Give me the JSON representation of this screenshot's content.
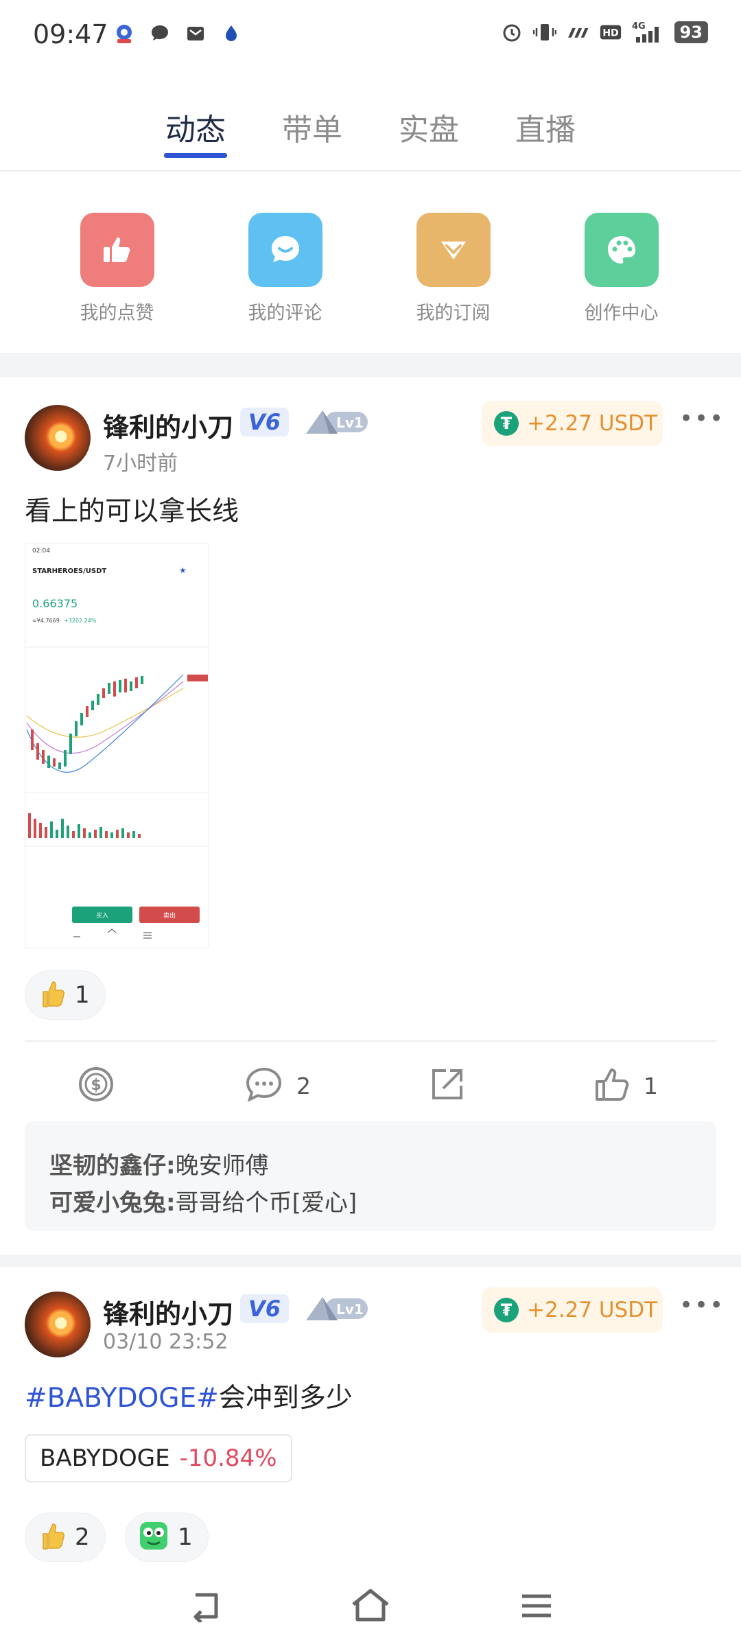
{
  "status_bar": {
    "time": "09:47",
    "battery": "93",
    "network": "4G"
  },
  "tabs": [
    {
      "label": "动态",
      "active": true
    },
    {
      "label": "带单",
      "active": false
    },
    {
      "label": "实盘",
      "active": false
    },
    {
      "label": "直播",
      "active": false
    }
  ],
  "quick_actions": [
    {
      "label": "我的点赞",
      "icon": "thumbs-up-icon",
      "color": "#ef7d7b"
    },
    {
      "label": "我的评论",
      "icon": "chat-bubble-icon",
      "color": "#5fc0f2"
    },
    {
      "label": "我的订阅",
      "icon": "subscribe-icon",
      "color": "#e8b66b"
    },
    {
      "label": "创作中心",
      "icon": "palette-icon",
      "color": "#5ccf9a"
    }
  ],
  "posts": [
    {
      "author": "锋利的小刀",
      "vip": "V6",
      "level": "Lv1",
      "time": "7小时前",
      "tip": "+2.27 USDT",
      "text": "看上的可以拿长线",
      "screenshot": {
        "status_time": "02:04",
        "pair": "STARHEROES/USDT",
        "price": "0.66375",
        "cny": "≈¥4.7669",
        "change": "+3202.24%",
        "buy": "买入",
        "sell": "卖出"
      },
      "reactions": [
        {
          "emoji": "thumbs-up",
          "count": "1"
        }
      ],
      "actions": {
        "comments": "2",
        "likes": "1"
      },
      "comments": [
        {
          "user": "坚韧的鑫仔",
          "text": "晚安师傅"
        },
        {
          "user": "可爱小兔兔",
          "text": "哥哥给个币[爱心]"
        }
      ]
    },
    {
      "author": "锋利的小刀",
      "vip": "V6",
      "level": "Lv1",
      "time": "03/10 23:52",
      "tip": "+2.27 USDT",
      "hashtag": "#BABYDOGE#",
      "text": "会冲到多少",
      "coin": {
        "symbol": "BABYDOGE",
        "change": "-10.84%"
      },
      "reactions": [
        {
          "emoji": "thumbs-up",
          "count": "2"
        },
        {
          "emoji": "green-face",
          "count": "1"
        }
      ]
    }
  ]
}
